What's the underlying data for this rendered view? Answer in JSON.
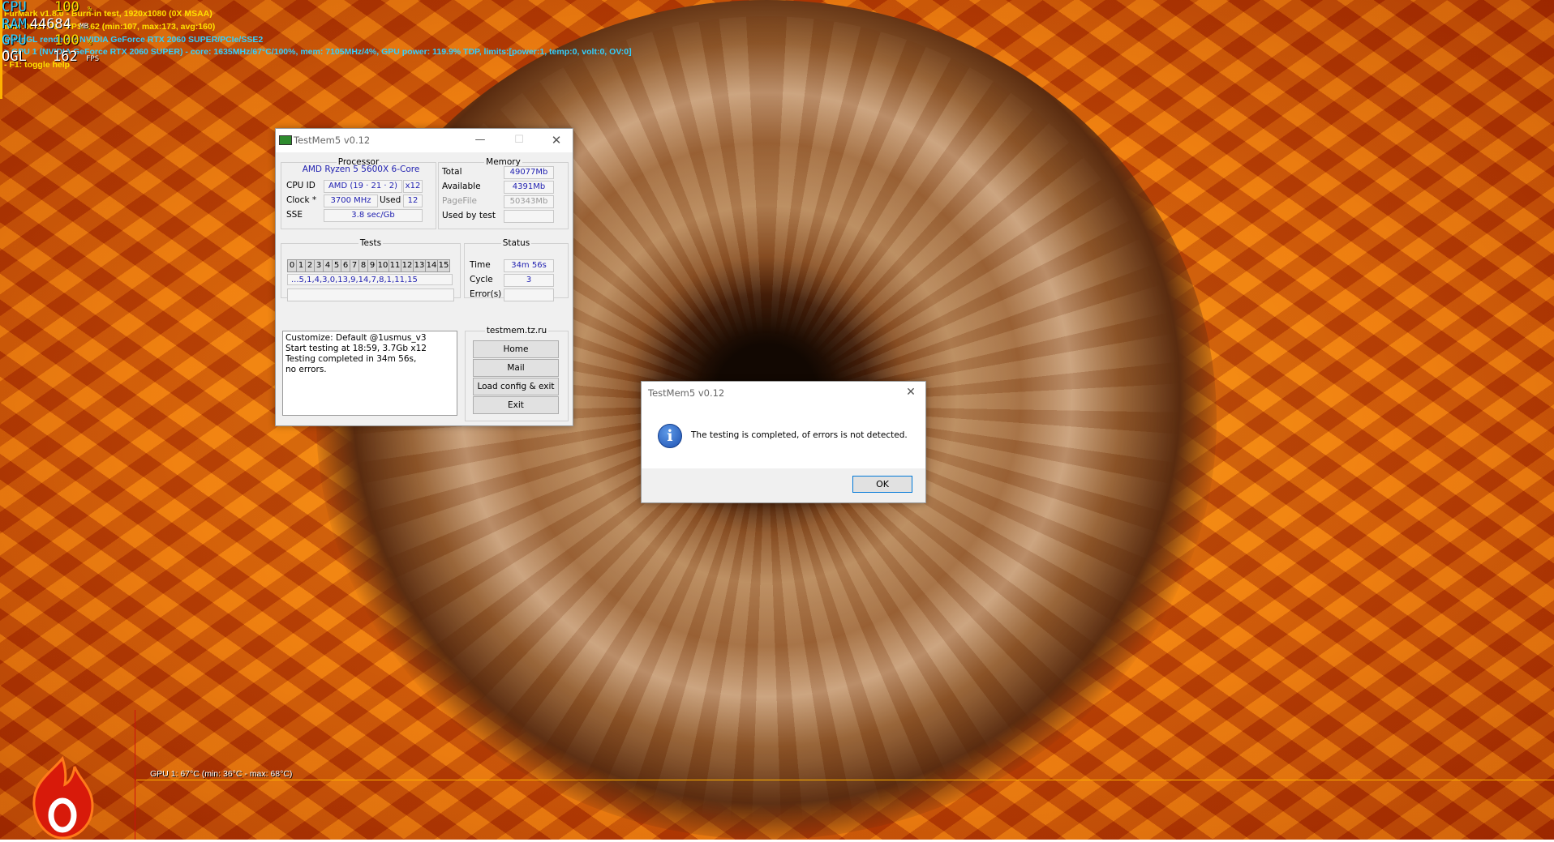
{
  "osd": {
    "line1": "FurMark v1.8.0 - Burn-in test, 1920x1080 (0X MSAA)",
    "line2": "time:00:37:36 - FPS:162 (min:107, max:173, avg:160)",
    "line3": "OpenGL renderer: NVIDIA GeForce RTX 2060 SUPER/PCIe/SSE2",
    "line4": "> GPU 1 (NVIDIA GeForce RTX 2060 SUPER) - core: 1635MHz/67°C/100%, mem: 7105MHz/4%, GPU power: 119.9% TDP, limits:[power:1, temp:0, volt:0, OV:0]",
    "line5": "- F1: toggle help",
    "big": [
      {
        "label": "CPU",
        "value": "100",
        "unit": "%"
      },
      {
        "label": "RAM",
        "value": "44684",
        "unit": "MB"
      },
      {
        "label": "GPU",
        "value": "100",
        "unit": "%"
      },
      {
        "label": "OGL",
        "value": "162",
        "unit": "FPS"
      }
    ],
    "gpu_graph_label": "GPU 1: 67°C (min: 36°C - max: 68°C)",
    "colors": {
      "yellow": "#ffe000",
      "cyan": "#33d0ff",
      "orange": "#ffb300"
    }
  },
  "testmem": {
    "title": "TestMem5 v0.12",
    "processor": {
      "legend": "Processor",
      "name": "AMD Ryzen 5 5600X 6-Core",
      "cpu_id_label": "CPU ID",
      "cpu_id_value": "AMD  (19 · 21 · 2)",
      "threads": "x12",
      "clock_label": "Clock *",
      "clock_value": "3700 MHz",
      "used_label": "Used",
      "used_value": "12",
      "sse_label": "SSE",
      "sse_value": "3.8 sec/Gb"
    },
    "memory": {
      "legend": "Memory",
      "total_label": "Total",
      "total_value": "49077Mb",
      "available_label": "Available",
      "available_value": "4391Mb",
      "pagefile_label": "PageFile",
      "pagefile_value": "50343Mb",
      "usedbytest_label": "Used by test",
      "usedbytest_value": ""
    },
    "tests": {
      "legend": "Tests",
      "cells": [
        "0",
        "1",
        "2",
        "3",
        "4",
        "5",
        "6",
        "7",
        "8",
        "9",
        "10",
        "11",
        "12",
        "13",
        "14",
        "15"
      ],
      "sequence": "...5,1,4,3,0,13,9,14,7,8,1,11,15",
      "progress": ""
    },
    "status": {
      "legend": "Status",
      "time_label": "Time",
      "time_value": "34m 56s",
      "cycle_label": "Cycle",
      "cycle_value": "3",
      "errors_label": "Error(s)",
      "errors_value": ""
    },
    "log": [
      "Customize: Default @1usmus_v3",
      "Start testing at 18:59, 3.7Gb x12",
      "Testing completed in 34m 56s,",
      "no errors."
    ],
    "links": {
      "legend": "testmem.tz.ru",
      "home": "Home",
      "mail": "Mail",
      "load": "Load config & exit",
      "exit": "Exit"
    }
  },
  "dialog": {
    "title": "TestMem5 v0.12",
    "message": "The testing is completed, of errors is not detected.",
    "ok": "OK"
  }
}
